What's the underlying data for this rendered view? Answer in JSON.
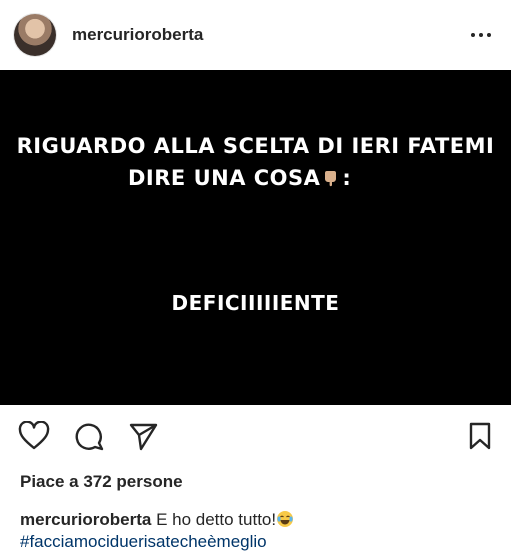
{
  "header": {
    "username": "mercurioroberta",
    "more_icon": "more-horizontal-icon"
  },
  "post": {
    "line1": "RIGUARDO ALLA SCELTA DI IERI FATEMI",
    "line2": "DIRE UNA COSA",
    "line2_suffix": ":",
    "line3": "DEFICIIIIIENTE",
    "emoji_icon": "backhand-index-pointing-down-icon",
    "background": "#000000"
  },
  "actions": {
    "like_icon": "heart-icon",
    "comment_icon": "comment-icon",
    "share_icon": "send-icon",
    "save_icon": "bookmark-icon"
  },
  "likes": {
    "text": "Piace a 372 persone"
  },
  "caption": {
    "username": "mercurioroberta",
    "text": "E ho detto tutto!",
    "emoji_icon": "face-with-tears-of-joy-icon",
    "hashtag": "#facciamociduerisatecheèmeglio",
    "hashtag_color": "#003569"
  }
}
